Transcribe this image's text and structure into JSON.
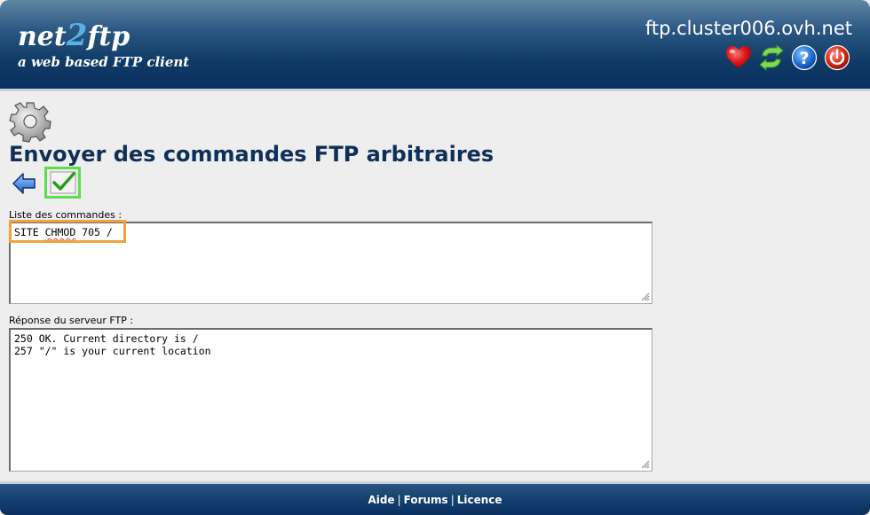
{
  "header": {
    "logo_part1": "net",
    "logo_part2": "2",
    "logo_part3": "ftp",
    "logo_subtitle": "a web based FTP client",
    "hostname": "ftp.cluster006.ovh.net",
    "icons": [
      "heart-icon",
      "refresh-icon",
      "help-icon",
      "power-icon"
    ]
  },
  "main": {
    "title": "Envoyer des commandes FTP arbitraires",
    "commands_label": "Liste des commandes :",
    "commands_value_prefix": "SITE ",
    "commands_value_word": "CHMOD",
    "commands_value_suffix": " 705 /",
    "response_label": "Réponse du serveur FTP :",
    "response_value": "250 OK. Current directory is /\n257 \"/\" is your current location"
  },
  "footer": {
    "help": "Aide",
    "forums": "Forums",
    "license": "Licence",
    "separator": "|"
  },
  "colors": {
    "title": "#0e2f57",
    "header_bg": "#0f3a66",
    "submit_highlight": "#5be04b",
    "command_highlight": "#f0a33c"
  }
}
